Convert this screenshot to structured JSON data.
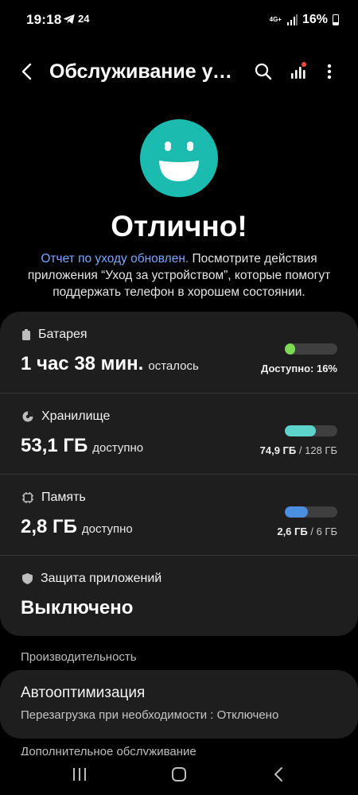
{
  "status_bar": {
    "time": "19:18",
    "notification": "24",
    "network": "4G+",
    "battery": "16%"
  },
  "app_bar": {
    "title": "Обслуживание устройства"
  },
  "hero": {
    "title": "Отлично!",
    "link": "Отчет по уходу обновлен.",
    "description": " Посмотрите действия приложения “Уход за устройством”, которые помогут поддержать телефон в хорошем состоянии."
  },
  "rows": {
    "battery": {
      "label": "Батарея",
      "value": "1 час 38 мин.",
      "suffix": "осталось",
      "meta_bold": "Доступно: 16%",
      "fill": 0.16,
      "color": "#7ed957"
    },
    "storage": {
      "label": "Хранилище",
      "value": "53,1 ГБ",
      "suffix": "доступно",
      "meta_bold": "74,9 ГБ",
      "meta_rest": " / 128 ГБ",
      "fill": 0.585,
      "color": "#5cd4cc"
    },
    "memory": {
      "label": "Память",
      "value": "2,8 ГБ",
      "suffix": "доступно",
      "meta_bold": "2,6 ГБ",
      "meta_rest": " / 6 ГБ",
      "fill": 0.433,
      "color": "#4a8fe0"
    },
    "protection": {
      "label": "Защита приложений",
      "value": "Выключено"
    }
  },
  "sections": {
    "performance": "Производительность",
    "auto_opt_title": "Автооптимизация",
    "auto_opt_sub": "Перезагрузка при необходимости : Отключено",
    "additional": "Дополнительное обслуживание"
  },
  "colors": {
    "accent": "#1bbbb0",
    "link": "#7aa7ff",
    "card": "#1e1e1e",
    "background": "#000000"
  }
}
